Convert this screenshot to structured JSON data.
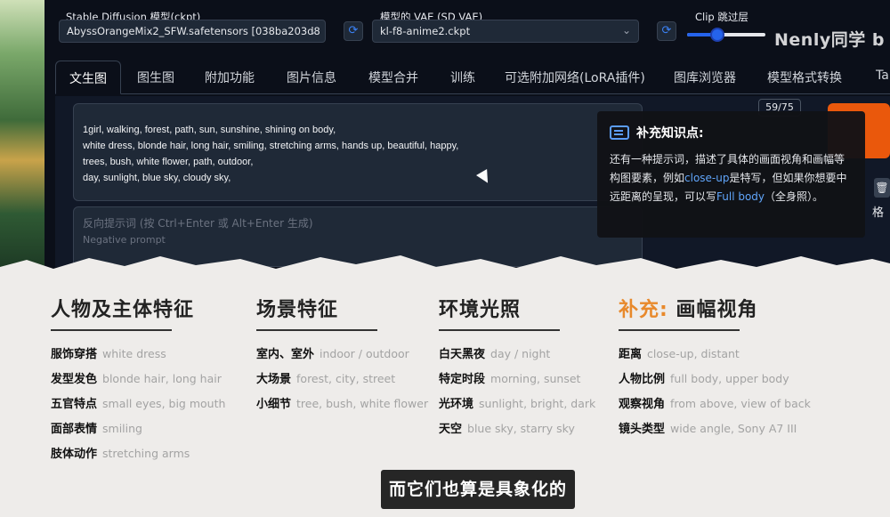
{
  "header": {
    "model_label": "Stable Diffusion 模型(ckpt)",
    "model_value": "AbyssOrangeMix2_SFW.safetensors [038ba203d8",
    "vae_label": "模型的 VAE (SD VAE)",
    "vae_value": "kl-f8-anime2.ckpt",
    "clip_label": "Clip 跳过层",
    "watermark": "Nenly同学 b"
  },
  "tabs": [
    {
      "label": "文生图",
      "active": true
    },
    {
      "label": "图生图"
    },
    {
      "label": "附加功能"
    },
    {
      "label": "图片信息"
    },
    {
      "label": "模型合并"
    },
    {
      "label": "训练"
    },
    {
      "label": "可选附加网络(LoRA插件)"
    },
    {
      "label": "图库浏览器"
    },
    {
      "label": "模型格式转换"
    },
    {
      "label": "Ta"
    }
  ],
  "prompt": {
    "lines": [
      "1girl, walking, forest, path, sun, sunshine, shining on body,",
      "white dress, blonde hair, long hair, smiling, stretching arms, hands up, beautiful, happy,",
      "trees, bush, white flower, path, outdoor,",
      "day, sunlight, blue sky, cloudy sky,"
    ],
    "token_count": "59/75",
    "negative_placeholder": "反向提示词 (按 Ctrl+Enter 或 Alt+Enter 生成)",
    "negative_sub": "Negative prompt",
    "side_char": "格"
  },
  "tip": {
    "title": "补充知识点:",
    "body_1": "还有一种提示词，描述了具体的画面视角和画幅等构图要素，例如",
    "hl_1": "close-up",
    "body_2": "是特写，但如果你想要中远距离的呈现，可以写",
    "hl_2": "Full body",
    "body_3": "（全身照）。",
    "accent_color": "#60a5fa"
  },
  "columns": [
    {
      "title": "人物及主体特征",
      "rows": [
        {
          "k": "服饰穿搭",
          "v": "white dress"
        },
        {
          "k": "发型发色",
          "v": "blonde hair, long hair"
        },
        {
          "k": "五官特点",
          "v": "small eyes, big mouth"
        },
        {
          "k": "面部表情",
          "v": "smiling"
        },
        {
          "k": "肢体动作",
          "v": "stretching arms"
        }
      ]
    },
    {
      "title": "场景特征",
      "rows": [
        {
          "k": "室内、室外",
          "v": "indoor / outdoor"
        },
        {
          "k": "大场景",
          "v": "forest, city, street"
        },
        {
          "k": "小细节",
          "v": "tree, bush, white flower"
        }
      ]
    },
    {
      "title": "环境光照",
      "rows": [
        {
          "k": "白天黑夜",
          "v": "day / night"
        },
        {
          "k": "特定时段",
          "v": "morning, sunset"
        },
        {
          "k": "光环境",
          "v": "sunlight, bright, dark"
        },
        {
          "k": "天空",
          "v": "blue sky, starry sky"
        }
      ]
    },
    {
      "title_accent": "补充:",
      "title": "画幅视角",
      "accent_color": "#e8892b",
      "rows": [
        {
          "k": "距离",
          "v": "close-up, distant"
        },
        {
          "k": "人物比例",
          "v": "full body, upper body"
        },
        {
          "k": "观察视角",
          "v": "from above, view of back"
        },
        {
          "k": "镜头类型",
          "v": "wide angle, Sony A7 III"
        }
      ]
    }
  ],
  "subtitle": "而它们也算是具象化的"
}
